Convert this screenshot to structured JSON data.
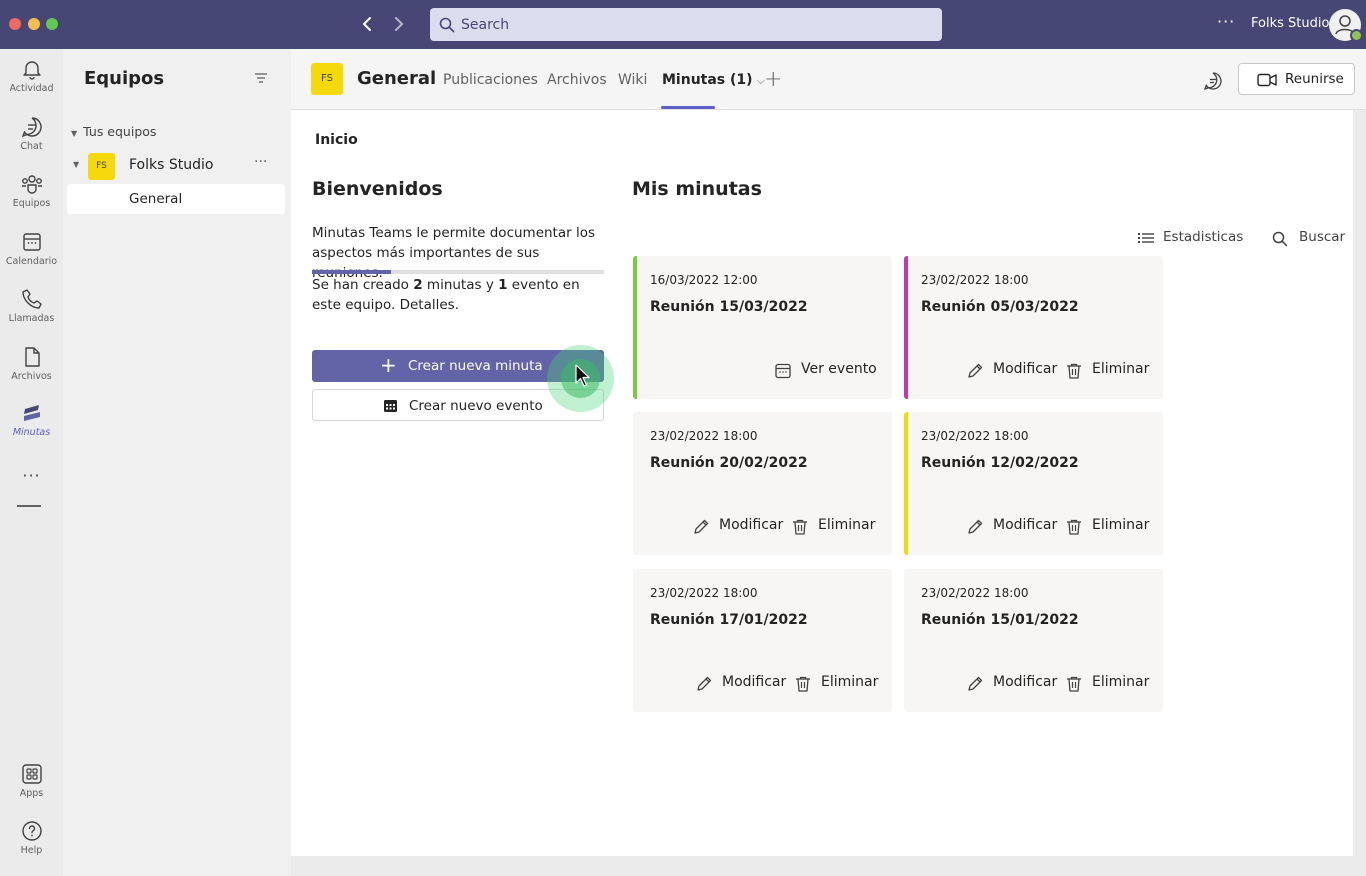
{
  "titlebar": {
    "search_placeholder": "Search",
    "more": "···",
    "org_name": "Folks Studio"
  },
  "rail": {
    "items": [
      {
        "label": "Actividad",
        "icon": "bell-icon"
      },
      {
        "label": "Chat",
        "icon": "chat-icon"
      },
      {
        "label": "Equipos",
        "icon": "teams-icon"
      },
      {
        "label": "Calendario",
        "icon": "calendar-icon"
      },
      {
        "label": "Llamadas",
        "icon": "phone-icon"
      },
      {
        "label": "Archivos",
        "icon": "file-icon"
      },
      {
        "label": "Minutas",
        "icon": "minutas-app-icon"
      },
      {
        "label": "Apps",
        "icon": "apps-icon"
      },
      {
        "label": "Help",
        "icon": "help-icon"
      }
    ],
    "more": "···"
  },
  "teams_panel": {
    "title": "Equipos",
    "section": "Tus equipos",
    "team": {
      "initials": "FS",
      "name": "Folks Studio",
      "more": "···"
    },
    "channel": "General"
  },
  "channel_header": {
    "initials": "FS",
    "name": "General",
    "tabs": [
      "Publicaciones",
      "Archivos",
      "Wiki",
      "Minutas (1)"
    ],
    "active_tab": "Minutas (1)",
    "meet_label": "Reunirse"
  },
  "content": {
    "breadcrumb": "Inicio",
    "welcome": {
      "title": "Bienvenidos",
      "description": "Minutas Teams le permite documentar los aspectos más importantes de sus reuniones.",
      "progress": 0.27,
      "stats_prefix": "Se han creado ",
      "minutes_count": "2",
      "stats_middle": " minutas y ",
      "events_count": "1",
      "stats_suffix": " evento en este equipo. Detalles."
    },
    "buttons": {
      "new_minute": "Crear nueva minuta",
      "new_event": "Crear nuevo evento"
    },
    "minutes": {
      "title": "Mis minutas",
      "stats_label": "Estadisticas",
      "search_label": "Buscar",
      "view_event": "Ver evento",
      "edit": "Modificar",
      "delete": "Eliminar",
      "cards": [
        {
          "date": "16/03/2022 12:00",
          "name": "Reunión 15/03/2022",
          "accent": "#7ac943",
          "type": "event"
        },
        {
          "date": "23/02/2022 18:00",
          "name": "Reunión 05/03/2022",
          "accent": "#c239b3",
          "type": "minute"
        },
        {
          "date": "23/02/2022 18:00",
          "name": "Reunión 20/02/2022",
          "accent": "",
          "type": "minute"
        },
        {
          "date": "23/02/2022 18:00",
          "name": "Reunión 12/02/2022",
          "accent": "#f5d90a",
          "type": "minute"
        },
        {
          "date": "23/02/2022 18:00",
          "name": "Reunión 17/01/2022",
          "accent": "",
          "type": "minute"
        },
        {
          "date": "23/02/2022 18:00",
          "name": "Reunión 15/01/2022",
          "accent": "",
          "type": "minute"
        }
      ]
    }
  },
  "colors": {
    "titlebar": "#464775",
    "brand": "#6264a7",
    "accent_green": "#7ac943",
    "accent_magenta": "#c239b3",
    "accent_yellow": "#f5d90a"
  }
}
